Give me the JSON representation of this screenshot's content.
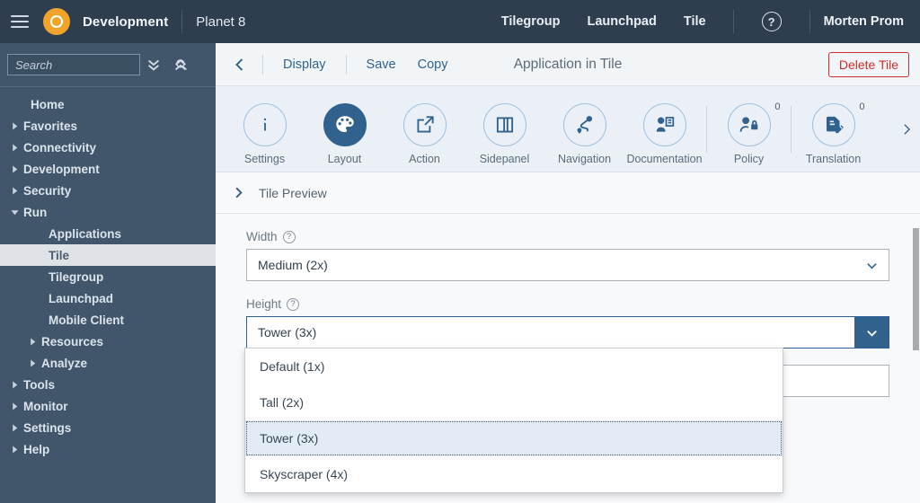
{
  "header": {
    "brand": "Development",
    "system": "Planet 8",
    "links": [
      "Tilegroup",
      "Launchpad",
      "Tile"
    ],
    "help_label": "?",
    "user": "Morten Prom"
  },
  "sidebar": {
    "search": {
      "placeholder": "Search",
      "value": ""
    },
    "items": [
      {
        "label": "Home",
        "level": 0,
        "arrow": "none",
        "selected": false
      },
      {
        "label": "Favorites",
        "level": 0,
        "arrow": "collapsed",
        "selected": false
      },
      {
        "label": "Connectivity",
        "level": 0,
        "arrow": "collapsed",
        "selected": false
      },
      {
        "label": "Development",
        "level": 0,
        "arrow": "collapsed",
        "selected": false
      },
      {
        "label": "Security",
        "level": 0,
        "arrow": "collapsed",
        "selected": false
      },
      {
        "label": "Run",
        "level": 0,
        "arrow": "expanded",
        "selected": false
      },
      {
        "label": "Applications",
        "level": 1,
        "arrow": "none",
        "selected": false
      },
      {
        "label": "Tile",
        "level": 1,
        "arrow": "none",
        "selected": true
      },
      {
        "label": "Tilegroup",
        "level": 1,
        "arrow": "none",
        "selected": false
      },
      {
        "label": "Launchpad",
        "level": 1,
        "arrow": "none",
        "selected": false
      },
      {
        "label": "Mobile Client",
        "level": 1,
        "arrow": "none",
        "selected": false
      },
      {
        "label": "Resources",
        "level": 1,
        "arrow": "collapsed",
        "selected": false
      },
      {
        "label": "Analyze",
        "level": 1,
        "arrow": "collapsed",
        "selected": false
      },
      {
        "label": "Tools",
        "level": 0,
        "arrow": "collapsed",
        "selected": false
      },
      {
        "label": "Monitor",
        "level": 0,
        "arrow": "collapsed",
        "selected": false
      },
      {
        "label": "Settings",
        "level": 0,
        "arrow": "collapsed",
        "selected": false
      },
      {
        "label": "Help",
        "level": 0,
        "arrow": "collapsed",
        "selected": false
      }
    ]
  },
  "action_bar": {
    "display": "Display",
    "save": "Save",
    "copy": "Copy",
    "title": "Application in Tile",
    "delete": "Delete Tile"
  },
  "icon_tabs": [
    {
      "label": "Settings",
      "icon": "info-icon",
      "active": false,
      "badge": null,
      "sep_before": false
    },
    {
      "label": "Layout",
      "icon": "palette-icon",
      "active": true,
      "badge": null,
      "sep_before": false
    },
    {
      "label": "Action",
      "icon": "share-icon",
      "active": false,
      "badge": null,
      "sep_before": false
    },
    {
      "label": "Sidepanel",
      "icon": "columns-icon",
      "active": false,
      "badge": null,
      "sep_before": false
    },
    {
      "label": "Navigation",
      "icon": "route-icon",
      "active": false,
      "badge": null,
      "sep_before": false
    },
    {
      "label": "Documentation",
      "icon": "person-doc-icon",
      "active": false,
      "badge": null,
      "sep_before": false
    },
    {
      "label": "Policy",
      "icon": "person-lock-icon",
      "active": false,
      "badge": "0",
      "sep_before": true
    },
    {
      "label": "Translation",
      "icon": "doc-pencil-icon",
      "active": false,
      "badge": "0",
      "sep_before": true
    }
  ],
  "content": {
    "preview_section": "Tile Preview",
    "width": {
      "label": "Width",
      "value": "Medium (2x)"
    },
    "height": {
      "label": "Height",
      "value": "Tower (3x)",
      "options": [
        {
          "label": "Default (1x)",
          "selected": false
        },
        {
          "label": "Tall (2x)",
          "selected": false
        },
        {
          "label": "Tower (3x)",
          "selected": true
        },
        {
          "label": "Skyscraper (4x)",
          "selected": false
        }
      ]
    },
    "hidden_field": {
      "value": ""
    }
  },
  "colors": {
    "shell_header": "#2e3e4f",
    "sidebar": "#41566b",
    "accent_blue": "#31628d",
    "brand_orange": "#f0a42a",
    "danger_red": "#c9302c",
    "selected_row": "#e1ecf7"
  }
}
